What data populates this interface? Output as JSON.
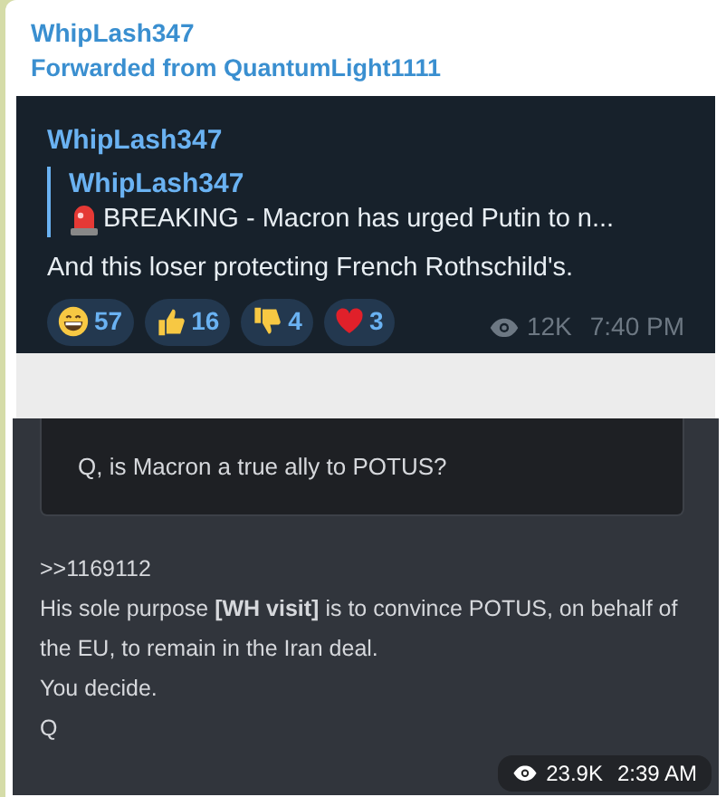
{
  "message": {
    "author": "WhipLash347",
    "forwarded_from": "Forwarded from QuantumLight1111",
    "image": {
      "post": {
        "author": "WhipLash347",
        "reply": {
          "author": "WhipLash347",
          "text": "BREAKING - Macron has urged Putin to n..."
        },
        "text": "And this loser protecting French Rothschild's.",
        "reactions": [
          {
            "kind": "grin",
            "count": "57"
          },
          {
            "kind": "thumbs_up",
            "count": "16"
          },
          {
            "kind": "thumbs_down",
            "count": "4"
          },
          {
            "kind": "heart",
            "count": "3"
          }
        ],
        "views": "12K",
        "time": "7:40 PM"
      },
      "q_post": {
        "quote": "Q, is Macron a true ally to POTUS?",
        "lines": [
          ">>1169112",
          "His sole purpose **[WH visit]** is to convince POTUS, on behalf of the EU, to remain in the Iran deal.",
          "You decide.",
          "Q"
        ]
      }
    },
    "views": "23.9K",
    "time": "2:39 AM"
  }
}
